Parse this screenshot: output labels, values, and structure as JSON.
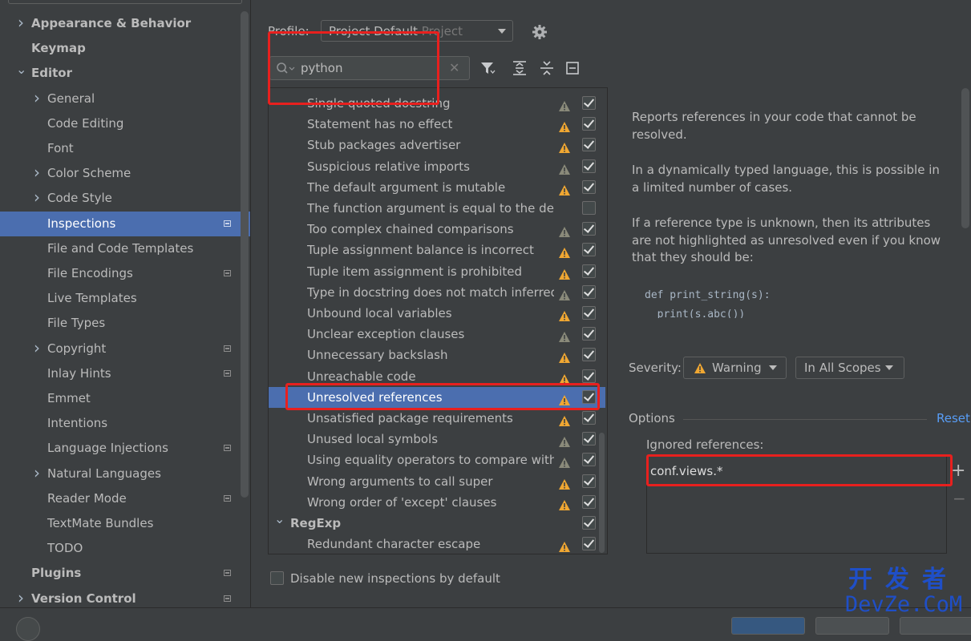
{
  "sidebar": {
    "items": [
      {
        "label": "Appearance & Behavior",
        "chevron": "right",
        "bold": true,
        "badge": false
      },
      {
        "label": "Keymap",
        "chevron": "",
        "bold": true,
        "badge": false
      },
      {
        "label": "Editor",
        "chevron": "down",
        "bold": true,
        "badge": false
      },
      {
        "label": "General",
        "chevron": "right",
        "bold": false,
        "badge": false
      },
      {
        "label": "Code Editing",
        "chevron": "",
        "bold": false,
        "badge": false
      },
      {
        "label": "Font",
        "chevron": "",
        "bold": false,
        "badge": false
      },
      {
        "label": "Color Scheme",
        "chevron": "right",
        "bold": false,
        "badge": false
      },
      {
        "label": "Code Style",
        "chevron": "right",
        "bold": false,
        "badge": false
      },
      {
        "label": "Inspections",
        "chevron": "",
        "bold": false,
        "badge": true,
        "selected": true
      },
      {
        "label": "File and Code Templates",
        "chevron": "",
        "bold": false,
        "badge": false
      },
      {
        "label": "File Encodings",
        "chevron": "",
        "bold": false,
        "badge": true
      },
      {
        "label": "Live Templates",
        "chevron": "",
        "bold": false,
        "badge": false
      },
      {
        "label": "File Types",
        "chevron": "",
        "bold": false,
        "badge": false
      },
      {
        "label": "Copyright",
        "chevron": "right",
        "bold": false,
        "badge": true
      },
      {
        "label": "Inlay Hints",
        "chevron": "",
        "bold": false,
        "badge": true
      },
      {
        "label": "Emmet",
        "chevron": "",
        "bold": false,
        "badge": false
      },
      {
        "label": "Intentions",
        "chevron": "",
        "bold": false,
        "badge": false
      },
      {
        "label": "Language Injections",
        "chevron": "",
        "bold": false,
        "badge": true
      },
      {
        "label": "Natural Languages",
        "chevron": "right",
        "bold": false,
        "badge": false
      },
      {
        "label": "Reader Mode",
        "chevron": "",
        "bold": false,
        "badge": true
      },
      {
        "label": "TextMate Bundles",
        "chevron": "",
        "bold": false,
        "badge": false
      },
      {
        "label": "TODO",
        "chevron": "",
        "bold": false,
        "badge": false
      },
      {
        "label": "Plugins",
        "chevron": "",
        "bold": true,
        "badge": true
      },
      {
        "label": "Version Control",
        "chevron": "right",
        "bold": true,
        "badge": true
      }
    ]
  },
  "toolbar": {
    "profile_label": "Profile:",
    "profile_value": "Project Default",
    "profile_scope": "Project",
    "search_value": "python"
  },
  "tree": {
    "rows": [
      {
        "label": "Single quoted docstring",
        "warn": "gray",
        "checked": true
      },
      {
        "label": "Statement has no effect",
        "warn": "yellow",
        "checked": true
      },
      {
        "label": "Stub packages advertiser",
        "warn": "yellow",
        "checked": true
      },
      {
        "label": "Suspicious relative imports",
        "warn": "gray",
        "checked": true
      },
      {
        "label": "The default argument is mutable",
        "warn": "yellow",
        "checked": true
      },
      {
        "label": "The function argument is equal to the defa",
        "warn": "",
        "checked": false
      },
      {
        "label": "Too complex chained comparisons",
        "warn": "gray",
        "checked": true
      },
      {
        "label": "Tuple assignment balance is incorrect",
        "warn": "yellow",
        "checked": true
      },
      {
        "label": "Tuple item assignment is prohibited",
        "warn": "yellow",
        "checked": true
      },
      {
        "label": "Type in docstring does not match inferred",
        "warn": "gray",
        "checked": true
      },
      {
        "label": "Unbound local variables",
        "warn": "yellow",
        "checked": true
      },
      {
        "label": "Unclear exception clauses",
        "warn": "gray",
        "checked": true
      },
      {
        "label": "Unnecessary backslash",
        "warn": "yellow",
        "checked": true
      },
      {
        "label": "Unreachable code",
        "warn": "yellow",
        "checked": true
      },
      {
        "label": "Unresolved references",
        "warn": "yellow",
        "checked": true,
        "selected": true
      },
      {
        "label": "Unsatisfied package requirements",
        "warn": "yellow",
        "checked": true
      },
      {
        "label": "Unused local symbols",
        "warn": "gray",
        "checked": true
      },
      {
        "label": "Using equality operators to compare with",
        "warn": "gray",
        "checked": true
      },
      {
        "label": "Wrong arguments to call super",
        "warn": "yellow",
        "checked": true
      },
      {
        "label": "Wrong order of 'except' clauses",
        "warn": "yellow",
        "checked": true
      },
      {
        "label": "RegExp",
        "group": true,
        "checked": true
      },
      {
        "label": "Redundant character escape",
        "warn": "yellow",
        "checked": true
      }
    ]
  },
  "disable_new_label": "Disable new inspections by default",
  "description": {
    "p1": "Reports references in your code that cannot be resolved.",
    "p2": "In a dynamically typed language, this is possible in a limited number of cases.",
    "p3": "If a reference type is unknown, then its attributes are not highlighted as unresolved even if you know that they should be:",
    "code1": "def print_string(s):",
    "code2": "  print(s.abc())"
  },
  "severity": {
    "label": "Severity:",
    "value": "Warning",
    "scope": "In All Scopes"
  },
  "options": {
    "label": "Options",
    "reset": "Reset",
    "ignored_label": "Ignored references:",
    "ignored_items": [
      "conf.views.*"
    ]
  },
  "watermark": {
    "line1": "开发者",
    "line2": "DevZe.CoM"
  },
  "colors": {
    "accent": "#4b6eaf",
    "warning": "#f0a732",
    "highlight": "#e8201e",
    "link": "#589df6"
  }
}
